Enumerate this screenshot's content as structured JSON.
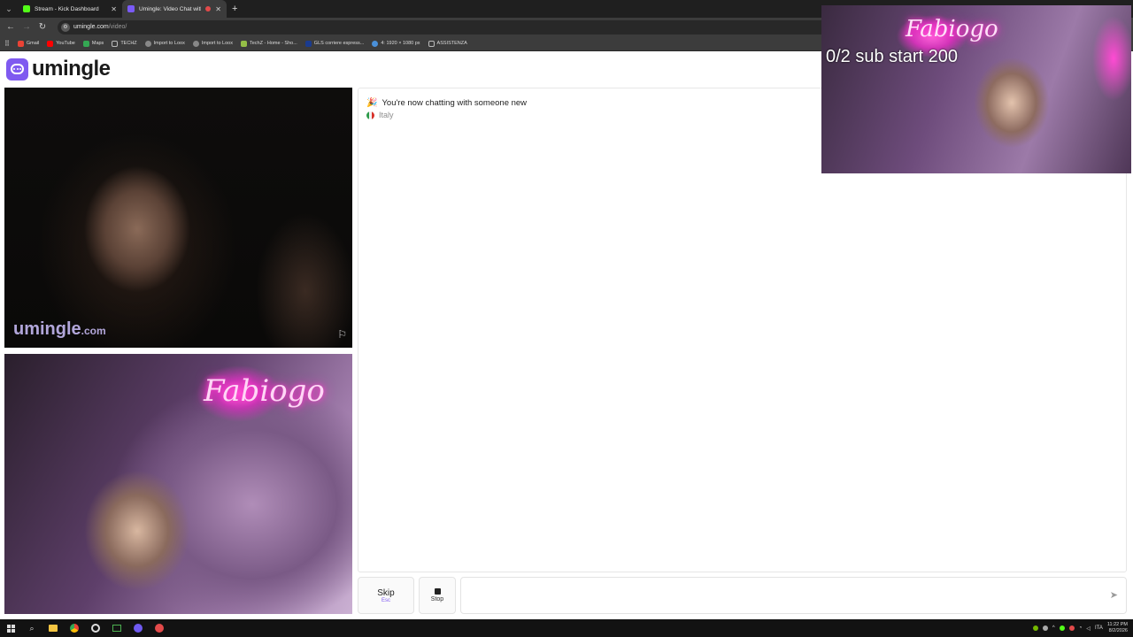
{
  "browser": {
    "tabs": [
      {
        "title": "Stream - Kick Dashboard",
        "favicon": "kick-icon"
      },
      {
        "title": "Umingle: Video Chat with S",
        "favicon": "umingle-icon",
        "recording": true
      }
    ],
    "url_host": "umingle.com",
    "url_path": "/video/",
    "bookmarks": [
      "Gmail",
      "YouTube",
      "Maps",
      "TECHZ",
      "Import to Loox",
      "Import to Loox",
      "TechZ - Home - Sho...",
      "GLS corriere espress...",
      "4: 1920 × 1080 px",
      "ASSISTENZA"
    ]
  },
  "page": {
    "brand": "umingle",
    "watermark_main": "umingle",
    "watermark_tld": ".com",
    "chat": {
      "status": "You're now chatting with someone new",
      "country": "Italy"
    },
    "controls": {
      "skip_label": "Skip",
      "skip_key": "Esc",
      "stop_label": "Stop",
      "message_placeholder": ""
    },
    "neon_sign": "Fabiogo"
  },
  "overlay": {
    "text": "0/2 sub start 200"
  },
  "taskbar": {
    "time": "11:22 PM",
    "date": "8/2/2026",
    "lang": "ITA"
  },
  "colors": {
    "brand": "#7f5af0",
    "tab_bar": "#1f1f1f",
    "toolbar": "#3c3c3c"
  }
}
